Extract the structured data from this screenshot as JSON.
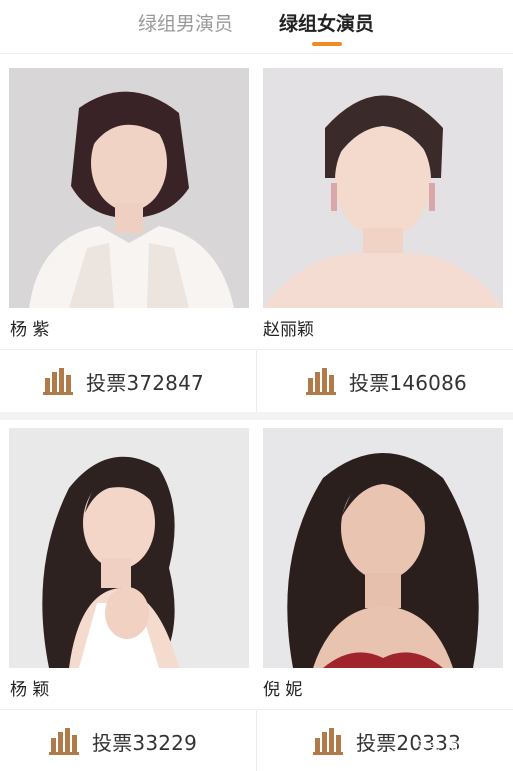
{
  "tabs": [
    {
      "label": "绿组男演员",
      "active": false
    },
    {
      "label": "绿组女演员",
      "active": true
    }
  ],
  "accent_color": "#f08a24",
  "vote_prefix": "投票",
  "cards": [
    {
      "name": "杨  紫",
      "vote": "投票372847",
      "icon": "bar-chart-icon"
    },
    {
      "name": "赵丽颖",
      "vote": "投票146086",
      "icon": "bar-chart-icon"
    },
    {
      "name": "杨  颖",
      "vote": "投票33229",
      "icon": "bar-chart-icon"
    },
    {
      "name": "倪  妮",
      "vote": "投票20333",
      "icon": "bar-chart-icon"
    }
  ],
  "watermark": {
    "text": "头条 @寻娱论",
    "logo": "toutiao-logo"
  }
}
